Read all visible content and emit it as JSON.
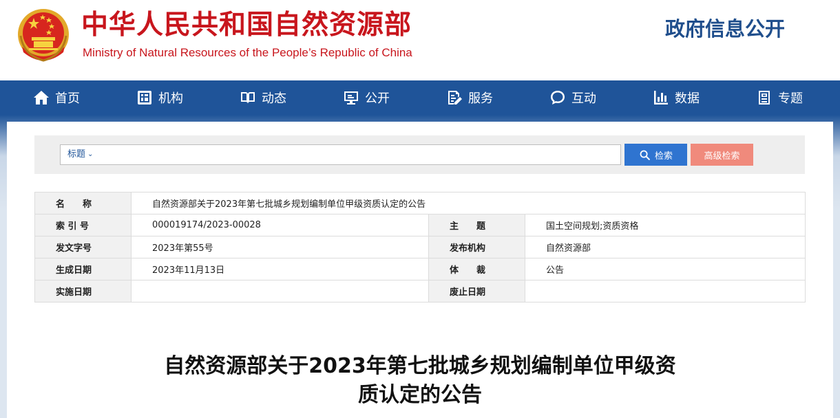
{
  "header": {
    "site_title_cn": "中华人民共和国自然资源部",
    "site_title_en": "Ministry of Natural Resources of the People’s Republic of China",
    "portal_title": "政府信息公开"
  },
  "nav": {
    "items": [
      {
        "label": "首页",
        "icon": "home-icon"
      },
      {
        "label": "机构",
        "icon": "organization-icon"
      },
      {
        "label": "动态",
        "icon": "book-icon"
      },
      {
        "label": "公开",
        "icon": "monitor-icon"
      },
      {
        "label": "服务",
        "icon": "edit-document-icon"
      },
      {
        "label": "互动",
        "icon": "chat-icon"
      },
      {
        "label": "数据",
        "icon": "bar-chart-icon"
      },
      {
        "label": "专题",
        "icon": "newspaper-icon"
      }
    ]
  },
  "search": {
    "type_label": "标题",
    "placeholder": "",
    "search_label": "检索",
    "advanced_label": "高级检索"
  },
  "info": {
    "name_label": "名　　称",
    "name_value": "自然资源部关于2023年第七批城乡规划编制单位甲级资质认定的公告",
    "index_label": "索 引 号",
    "index_value": "000019174/2023-00028",
    "subject_label": "主　　题",
    "subject_value": "国土空间规划;资质资格",
    "docno_label": "发文字号",
    "docno_value": "2023年第55号",
    "publisher_label": "发布机构",
    "publisher_value": "自然资源部",
    "created_label": "生成日期",
    "created_value": "2023年11月13日",
    "genre_label": "体　　裁",
    "genre_value": "公告",
    "effective_label": "实施日期",
    "effective_value": "",
    "expiry_label": "废止日期",
    "expiry_value": ""
  },
  "article": {
    "title_line1": "自然资源部关于2023年第七批城乡规划编制单位甲级资",
    "title_line2": "质认定的公告"
  },
  "colors": {
    "brand_red": "#c8161d",
    "nav_blue": "#1f5499",
    "search_blue": "#2f74d0",
    "advanced_salmon": "#f08a7c"
  }
}
